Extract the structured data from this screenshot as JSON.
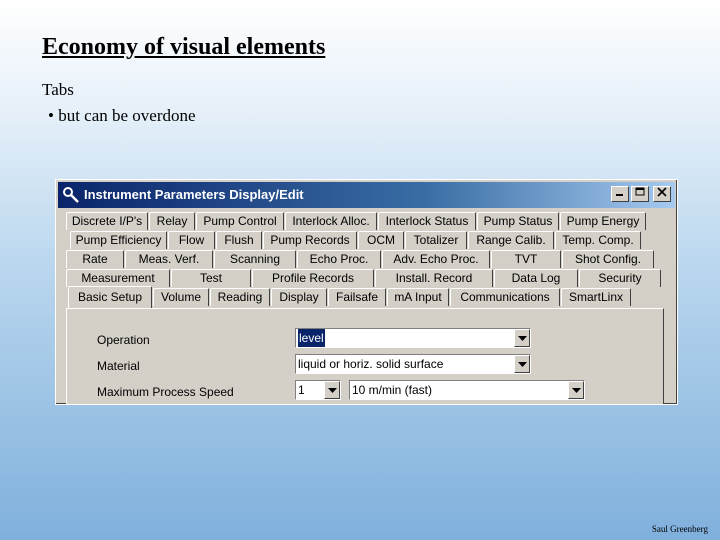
{
  "slide": {
    "title": "Economy of visual elements",
    "subtitle": "Tabs",
    "bullet": "• but can be overdone",
    "footer": "Saul Greenberg"
  },
  "window": {
    "title": "Instrument Parameters Display/Edit",
    "icons": {
      "app": "wrench-icon",
      "minimize": "minimize-icon",
      "maximize": "maximize-icon",
      "close": "close-icon"
    },
    "tab_rows": [
      [
        "Discrete I/P's",
        "Relay",
        "Pump Control",
        "Interlock Alloc.",
        "Interlock Status",
        "Pump Status",
        "Pump Energy"
      ],
      [
        "Pump Efficiency",
        "Flow",
        "Flush",
        "Pump Records",
        "OCM",
        "Totalizer",
        "Range Calib.",
        "Temp. Comp."
      ],
      [
        "Rate",
        "Meas. Verf.",
        "Scanning",
        "Echo Proc.",
        "Adv. Echo Proc.",
        "TVT",
        "Shot Config."
      ],
      [
        "Measurement",
        "Test",
        "Profile Records",
        "Install. Record",
        "Data Log",
        "Security"
      ],
      [
        "Basic Setup",
        "Volume",
        "Reading",
        "Display",
        "Failsafe",
        "mA Input",
        "Communications",
        "SmartLinx"
      ]
    ],
    "active_tab": "Basic Setup",
    "fields": {
      "operation": {
        "label": "Operation",
        "value": "level"
      },
      "material": {
        "label": "Material",
        "value": "liquid or horiz. solid surface"
      },
      "speed": {
        "label": "Maximum Process Speed",
        "index": "1",
        "value": "10 m/min (fast)"
      }
    }
  }
}
